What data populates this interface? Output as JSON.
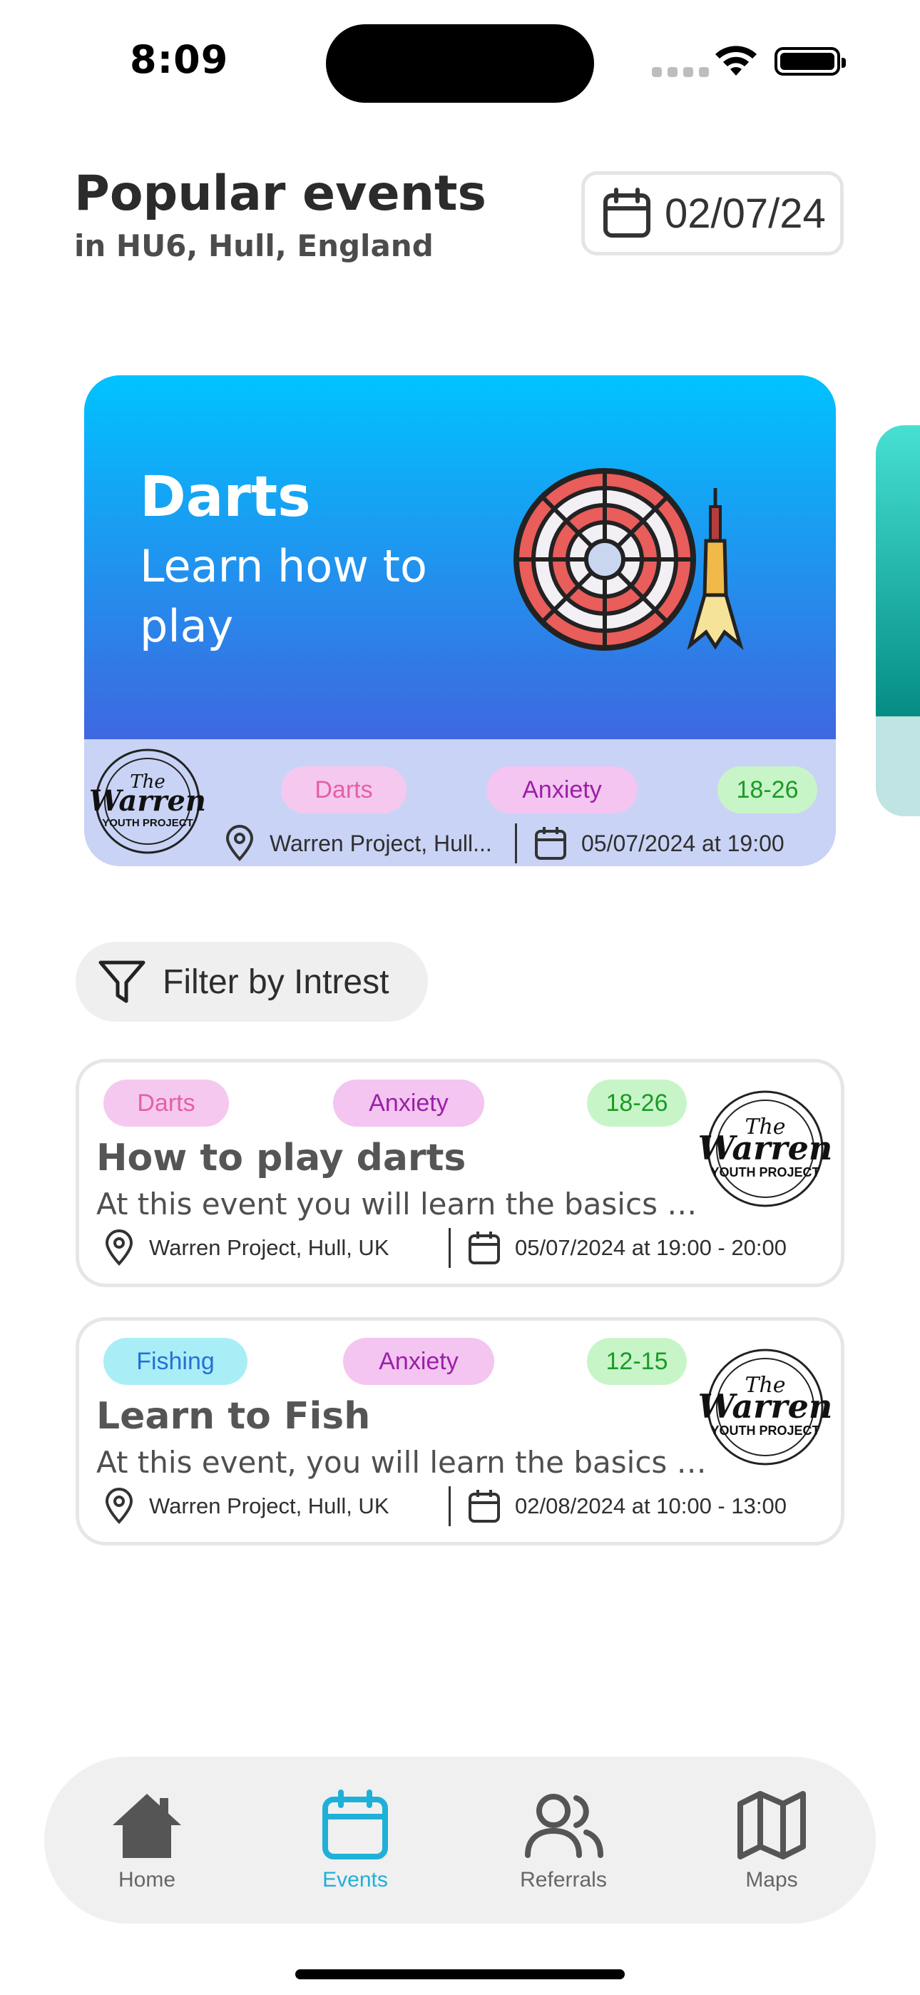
{
  "status": {
    "time": "8:09"
  },
  "header": {
    "title": "Popular events",
    "subtitle": "in HU6, Hull, England",
    "date": "02/07/24"
  },
  "featured": {
    "title": "Darts",
    "description": "Learn how to play",
    "tags": [
      "Darts",
      "Anxiety",
      "18-26"
    ],
    "location": "Warren Project, Hull...",
    "datetime": "05/07/2024 at 19:00",
    "logo": {
      "line1": "The",
      "line2": "Warren",
      "line3": "YOUTH PROJECT"
    }
  },
  "filter": {
    "label": "Filter by Intrest"
  },
  "events": [
    {
      "tags": [
        "Darts",
        "Anxiety",
        "18-26"
      ],
      "title": "How to play darts",
      "description": "At this event you will learn the basics of h...",
      "location": "Warren Project, Hull, UK",
      "datetime": "05/07/2024 at 19:00 - 20:00"
    },
    {
      "tags": [
        "Fishing",
        "Anxiety",
        "12-15"
      ],
      "title": "Learn to Fish",
      "description": "At this event, you will learn the basics of f...",
      "location": "Warren Project, Hull, UK",
      "datetime": "02/08/2024 at 10:00 - 13:00"
    }
  ],
  "tabs": [
    {
      "label": "Home",
      "icon": "home-icon"
    },
    {
      "label": "Events",
      "icon": "calendar-icon",
      "active": true
    },
    {
      "label": "Referrals",
      "icon": "users-icon"
    },
    {
      "label": "Maps",
      "icon": "map-icon"
    }
  ],
  "colors": {
    "accent": "#1fb0d8",
    "featured_gradient_top": "#00c3ff",
    "featured_gradient_bottom": "#3e67e0"
  }
}
